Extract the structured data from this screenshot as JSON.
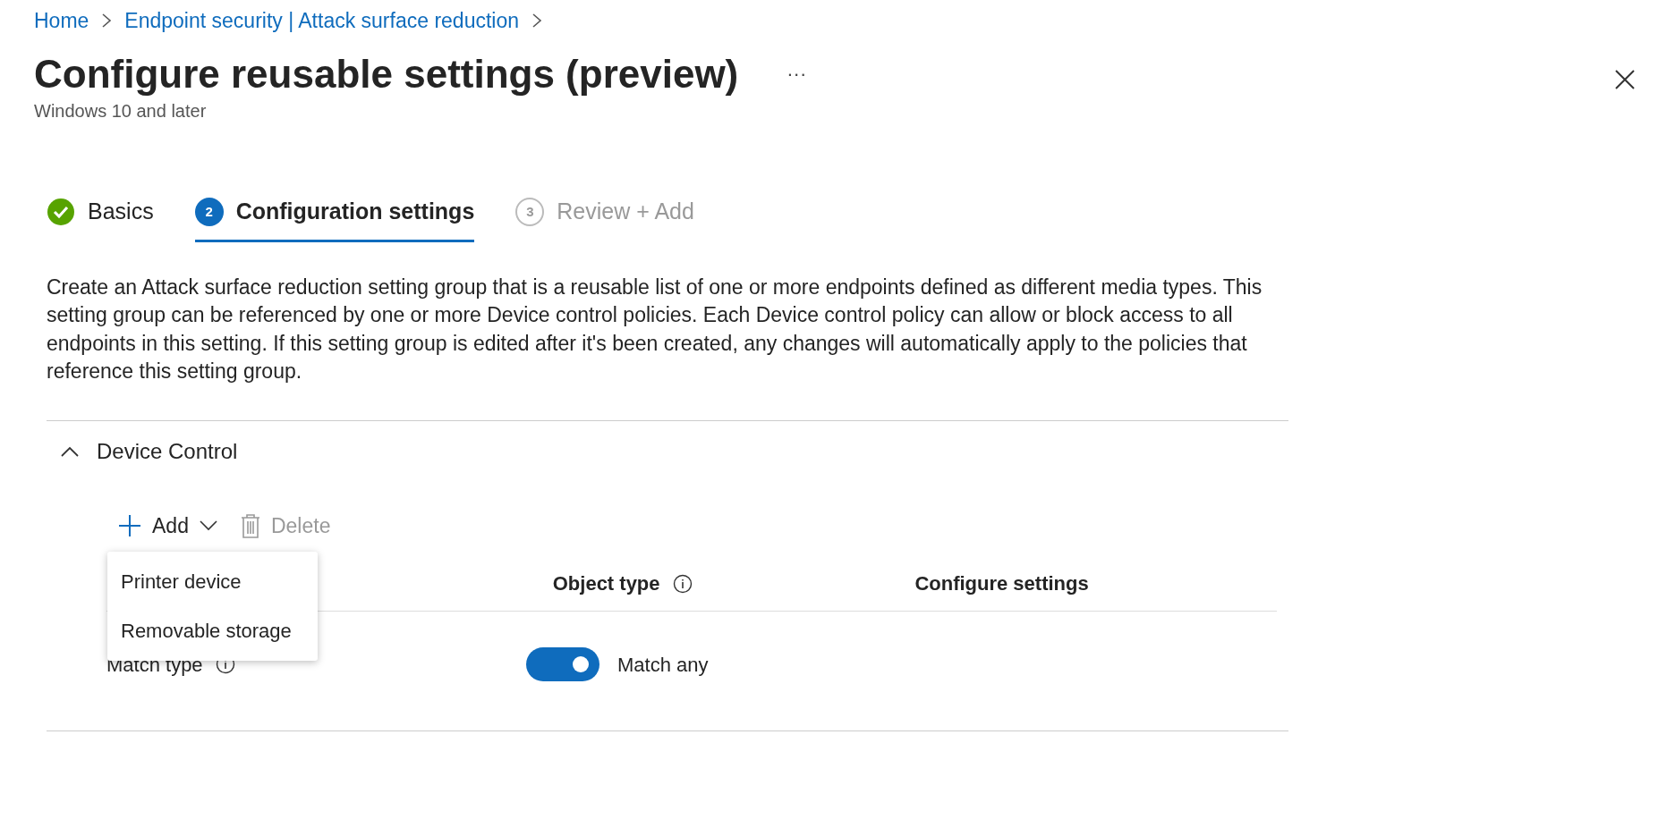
{
  "breadcrumb": [
    "Home",
    "Endpoint security | Attack surface reduction"
  ],
  "title": "Configure reusable settings (preview)",
  "more_label": "···",
  "subtitle": "Windows 10 and later",
  "steps": [
    {
      "label": "Basics",
      "kind": "complete",
      "selected": false
    },
    {
      "label": "Configuration settings",
      "number": "2",
      "kind": "current",
      "selected": true
    },
    {
      "label": "Review + Add",
      "number": "3",
      "kind": "pending",
      "selected": false
    }
  ],
  "description": "Create an Attack surface reduction setting group that is a reusable list of one or more endpoints defined as different media types. This setting group can be referenced by one or more Device control policies. Each Device control policy can allow or block access to all endpoints in this setting. If this setting group is edited after it's been created, any changes will automatically apply to the policies that reference this setting group.",
  "section": {
    "title": "Device Control",
    "expanded": true,
    "toolbar": [
      {
        "kind": "add",
        "label": "Add",
        "disabled": false
      },
      {
        "kind": "delete",
        "label": "Delete",
        "disabled": true
      }
    ],
    "add_menu": [
      "Printer device",
      "Removable storage"
    ],
    "columns": [
      {
        "label": "Object type",
        "info": true
      },
      {
        "label": "Configure settings",
        "info": false
      }
    ],
    "rows": [
      {
        "label": "Match type",
        "toggle_on": true,
        "toggle_label": "Match any"
      }
    ]
  }
}
